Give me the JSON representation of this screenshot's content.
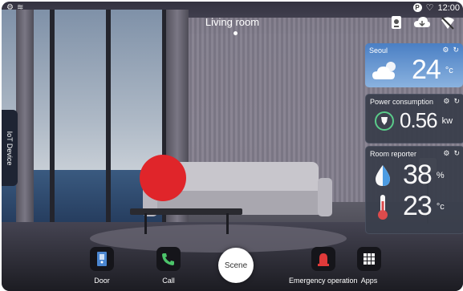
{
  "status_bar": {
    "time": "12:00",
    "left_icons": [
      "settings-icon",
      "wifi-icon"
    ],
    "right_icons": [
      "p-badge-icon",
      "heart-icon"
    ],
    "p_badge": "P"
  },
  "header": {
    "title": "Living room"
  },
  "top_icons": [
    "device-icon",
    "cloud-icon",
    "no-signal-icon"
  ],
  "side_tab": {
    "label": "IoT Device"
  },
  "cards": {
    "weather": {
      "city": "Seoul",
      "temperature": "24",
      "unit": "°c",
      "icon": "cloud-sun-icon"
    },
    "power": {
      "title": "Power consumption",
      "value": "0.56",
      "unit": "kw",
      "icon": "plug-icon"
    },
    "reporter": {
      "title": "Room reporter",
      "humidity": "38",
      "humidity_unit": "%",
      "temperature": "23",
      "temperature_unit": "°c"
    }
  },
  "dock": {
    "items": [
      {
        "label": "Door",
        "icon": "door-icon"
      },
      {
        "label": "Call",
        "icon": "phone-icon"
      },
      {
        "label": "Scene",
        "icon": "scene-icon"
      },
      {
        "label": "Emergency operation",
        "icon": "siren-icon"
      },
      {
        "label": "Apps",
        "icon": "grid-icon"
      }
    ]
  },
  "colors": {
    "accent_red": "#e0252a",
    "weather_card": "#4a7fc4",
    "card_dark": "#3a3f4c"
  }
}
